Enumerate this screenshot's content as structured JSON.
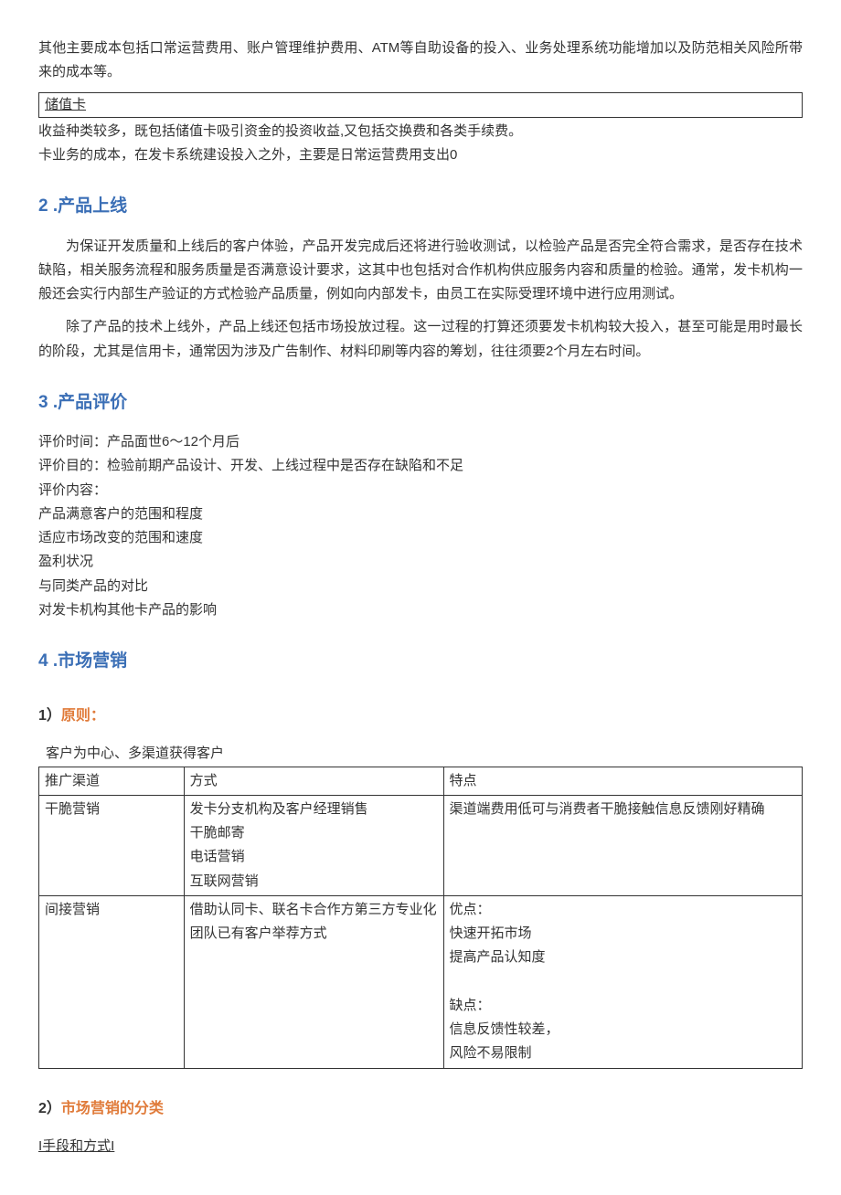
{
  "intro": {
    "p1": "其他主要成本包括口常运营费用、账户管理维护费用、ATM等自助设备的投入、业务处理系统功能增加以及防范相关风险所带来的成本等。",
    "box_label": "储值卡",
    "p2": "收益种类较多，既包括储值卡吸引资金的投资收益,又包括交换费和各类手续费。",
    "p3": "卡业务的成本，在发卡系统建设投入之外，主要是日常运营费用支出0"
  },
  "sec2": {
    "title": "2 .产品上线",
    "p1": "为保证开发质量和上线后的客户体验，产品开发完成后还将进行验收测试，以检验产品是否完全符合需求，是否存在技术缺陷，相关服务流程和服务质量是否满意设计要求，这其中也包括对合作机构供应服务内容和质量的检验。通常，发卡机构一般还会实行内部生产验证的方式检验产品质量，例如向内部发卡，由员工在实际受理环境中进行应用测试。",
    "p2": "除了产品的技术上线外，产品上线还包括市场投放过程。这一过程的打算还须要发卡机构较大投入，甚至可能是用时最长的阶段，尤其是信用卡，通常因为涉及广告制作、材料印刷等内容的筹划，往往须要2个月左右时间。"
  },
  "sec3": {
    "title": "3 .产品评价",
    "l1": "评价时间：产品面世6～12个月后",
    "l2": "评价目的：检验前期产品设计、开发、上线过程中是否存在缺陷和不足",
    "l3": "评价内容：",
    "l4": "产品满意客户的范围和程度",
    "l5": "适应市场改变的范围和速度",
    "l6": "盈利状况",
    "l7": "与同类产品的对比",
    "l8": "对发卡机构其他卡产品的影响"
  },
  "sec4": {
    "title": "4 .市场营销",
    "sub1_num": "1）",
    "sub1_txt": "原则：",
    "caption": "客户为中心、多渠道获得客户",
    "headers": {
      "c1": "推广渠道",
      "c2": "方式",
      "c3": "特点"
    },
    "row1": {
      "c1": "干脆营销",
      "c2": "发卡分支机构及客户经理销售\n干脆邮寄\n电话营销\n互联网营销",
      "c3": "渠道端费用低可与消费者干脆接触信息反馈刚好精确"
    },
    "row2": {
      "c1": "间接营销",
      "c2": "借助认同卡、联名卡合作方第三方专业化团队已有客户举荐方式",
      "c3": "优点：\n快速开拓市场\n提高产品认知度\n\n缺点：\n信息反馈性较差，\n风险不易限制"
    },
    "sub2_num": "2）",
    "sub2_txt": "市场营销的分类",
    "link": "I手段和方式I"
  }
}
